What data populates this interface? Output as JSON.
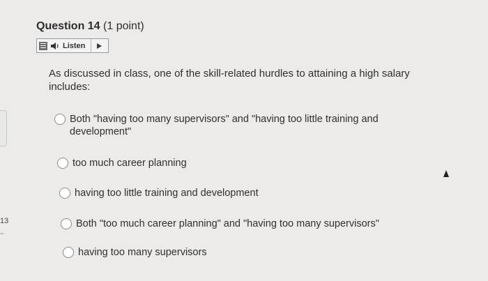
{
  "question": {
    "title": "Question 14",
    "points": "(1 point)",
    "prompt": "As discussed in class, one of the skill-related hurdles to attaining a high salary includes:"
  },
  "listen": {
    "label": "Listen",
    "icons": [
      "menu-icon",
      "speaker-icon",
      "play-icon"
    ]
  },
  "options": [
    "Both \"having too many supervisors\" and \"having too little training and development\"",
    "too much career planning",
    "having too little training and development",
    "Both \"too much career planning\" and \"having too many supervisors\"",
    "having too many supervisors"
  ],
  "side": {
    "question_number": "13",
    "status_mark": "--"
  }
}
